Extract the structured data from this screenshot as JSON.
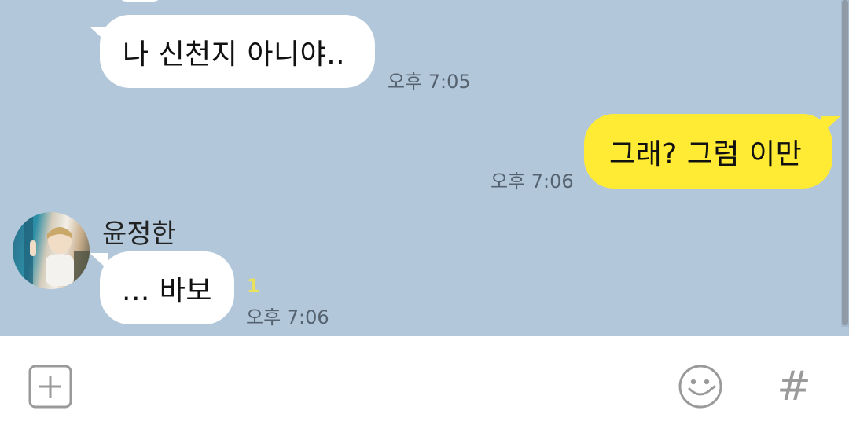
{
  "messages": [
    {
      "direction": "incoming",
      "text": "나 신천지 아니야..",
      "time": "오후 7:05"
    },
    {
      "direction": "outgoing",
      "text": "그래? 그럼 이만",
      "time": "오후 7:06"
    },
    {
      "direction": "incoming",
      "sender": "윤정한",
      "text": "... 바보",
      "time": "오후 7:06",
      "unread_count": "1"
    }
  ],
  "input_bar": {
    "icons": [
      "plus-box-icon",
      "emoji-smile-icon",
      "hashtag-icon"
    ],
    "hashtag_glyph": "#"
  },
  "colors": {
    "chat_background": "#b2c7d9",
    "incoming_bubble": "#ffffff",
    "outgoing_bubble": "#ffeb33",
    "unread_badge": "#e9e15c",
    "icon_gray": "#9a9a9a"
  }
}
